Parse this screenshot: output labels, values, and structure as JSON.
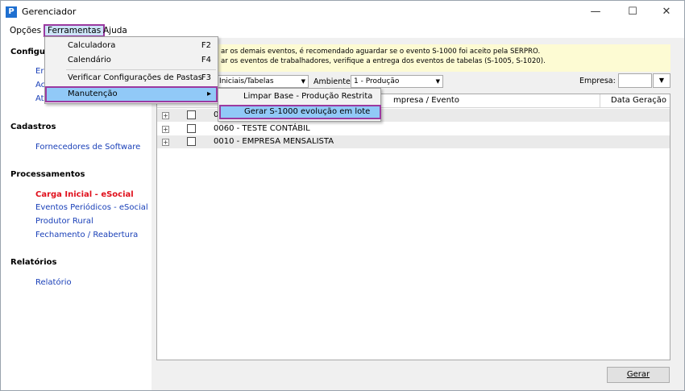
{
  "window": {
    "title": "Gerenciador",
    "app_icon": "P",
    "minimize": "—",
    "maximize": "☐",
    "close": "✕"
  },
  "menubar": {
    "items": [
      "Opções",
      "Ferramentas",
      "Ajuda"
    ]
  },
  "sidebar": {
    "configuracoes_head": "Configur",
    "config_links": [
      "Er",
      "Ac",
      "At"
    ],
    "cadastros_head": "Cadastros",
    "cadastros_links": [
      "Fornecedores de Software"
    ],
    "processamentos_head": "Processamentos",
    "processamentos_links": [
      "Carga Inicial - eSocial",
      "Eventos Periódicos - eSocial",
      "Produtor Rural",
      "Fechamento / Reabertura"
    ],
    "relatorios_head": "Relatórios",
    "relatorios_links": [
      "Relatório"
    ]
  },
  "warning": {
    "line1": "ar os demais eventos, é recomendado aguardar se o evento S-1000 foi aceito pela SERPRO.",
    "line2": "ar os eventos de trabalhadores, verifique a entrega dos eventos de tabelas (S-1005, S-1020)."
  },
  "toolbar": {
    "tipo_value": "os Iniciais/Tabelas",
    "ambiente_label": "Ambiente:",
    "ambiente_value": "1 - Produção",
    "empresa_label": "Empresa:",
    "empresa_value": ""
  },
  "grid": {
    "columns": [
      "mpresa / Evento",
      "Data Geração"
    ],
    "rows": [
      {
        "label": "0",
        "checked": false
      },
      {
        "label": "0060 - TESTE CONTÁBIL",
        "checked": false
      },
      {
        "label": "0010 - EMPRESA MENSALISTA",
        "checked": false
      }
    ]
  },
  "footer": {
    "gerar_label": "Gerar"
  },
  "ferramentas_menu": {
    "items": [
      {
        "label": "Calculadora",
        "shortcut": "F2"
      },
      {
        "label": "Calendário",
        "shortcut": "F4"
      },
      {
        "label": "Verificar Configurações de Pastas",
        "shortcut": "F3"
      },
      {
        "label": "Manutenção",
        "shortcut": "▸"
      }
    ]
  },
  "manutencao_submenu": {
    "items": [
      "Limpar Base - Produção Restrita",
      "Gerar S-1000 evolução em lote"
    ]
  },
  "colors": {
    "accent_highlight": "#9b3aa0",
    "link": "#1a40b8",
    "link_red": "#e0101c",
    "warning_bg": "#fdfbd3"
  }
}
